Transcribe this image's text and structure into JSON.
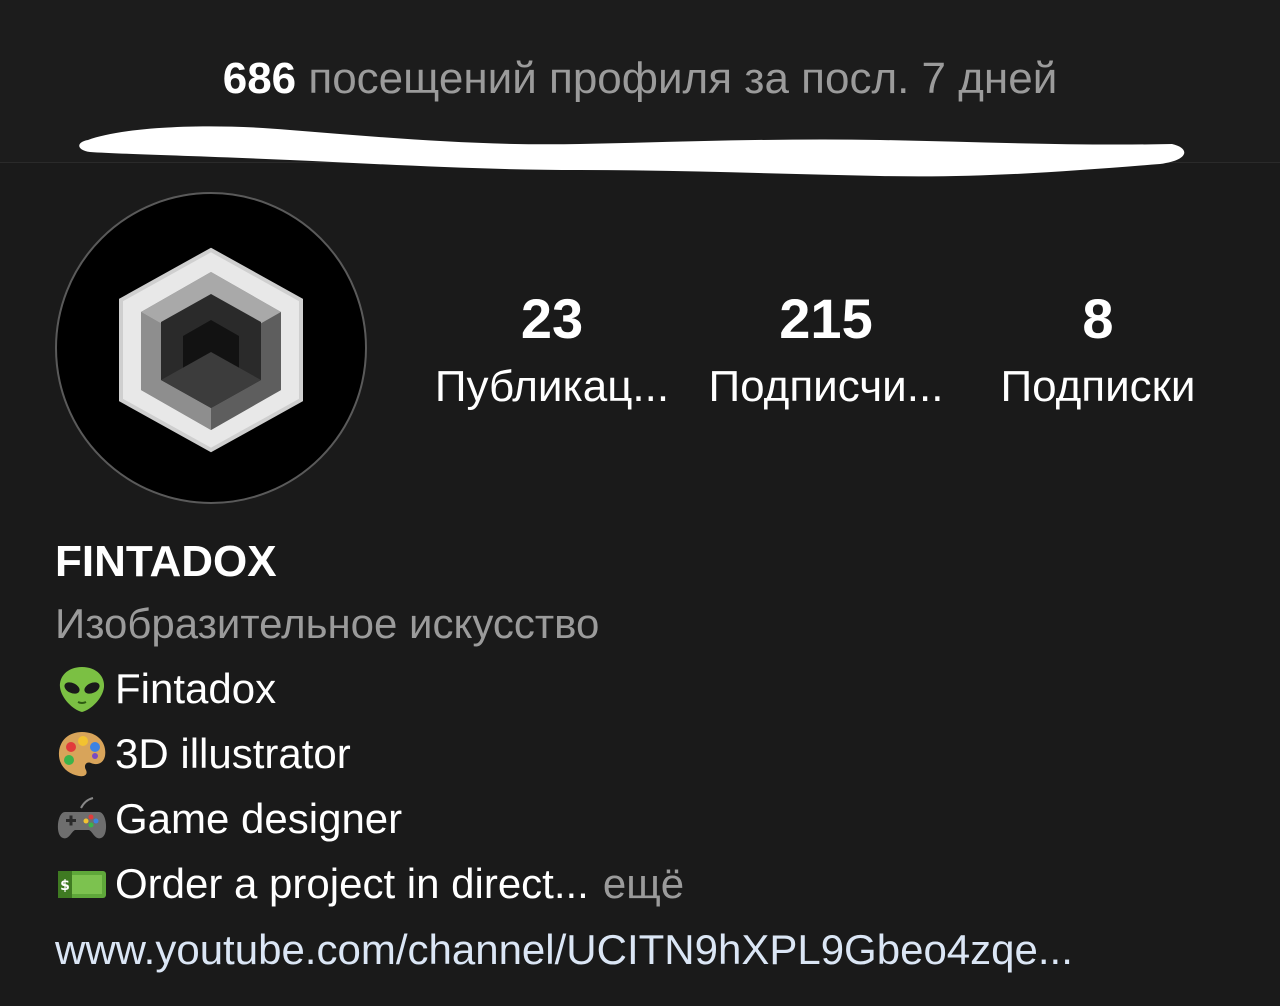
{
  "visits": {
    "count": "686",
    "text": "посещений профиля за посл. 7 дней"
  },
  "stats": {
    "posts": {
      "value": "23",
      "label": "Публикац..."
    },
    "followers": {
      "value": "215",
      "label": "Подписчи..."
    },
    "following": {
      "value": "8",
      "label": "Подписки"
    }
  },
  "profile": {
    "name": "FINTADOX",
    "category": "Изобразительное искусство",
    "bio_lines": [
      {
        "icon": "alien-emoji-icon",
        "text": "Fintadox"
      },
      {
        "icon": "artist-palette-emoji-icon",
        "text": "3D illustrator"
      },
      {
        "icon": "game-controller-emoji-icon",
        "text": "Game designer"
      },
      {
        "icon": "dollar-banknote-emoji-icon",
        "text": "Order a project in direct...",
        "more": "ещё"
      }
    ],
    "link": "www.youtube.com/channel/UCITN9hXPL9Gbeo4zqe..."
  },
  "colors": {
    "background": "#1a1a1a",
    "text_primary": "#ffffff",
    "text_secondary": "#9b9b9b",
    "link": "#dbe6f5"
  }
}
